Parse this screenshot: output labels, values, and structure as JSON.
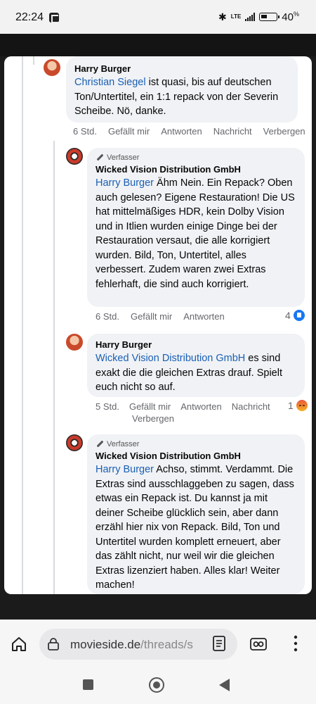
{
  "status_bar": {
    "time": "22:24",
    "network": "LTE",
    "battery": "40",
    "battery_unit": "%"
  },
  "comments": [
    {
      "author": "Harry Burger",
      "author_badge": "",
      "mention": "Christian Siegel",
      "text": " ist quasi, bis auf deutschen Ton/Untertitel, ein 1:1 repack von der Severin Scheibe. Nö, danke.",
      "time": "6 Std.",
      "actions": [
        "Gefällt mir",
        "Antworten",
        "Nachricht",
        "Verbergen"
      ]
    },
    {
      "author": "Wicked Vision Distribution GmbH",
      "author_badge": "Verfasser",
      "mention": "Harry Burger",
      "text": " Ähm Nein. Ein Repack? Oben auch gelesen? Eigene Restauration! Die US hat mittelmäßiges HDR, kein Dolby Vision und in Itlien wurden einige Dinge bei der Restauration versaut, die alle korrigiert wurden. Bild, Ton, Untertitel, alles verbessert. Zudem waren zwei Extras fehlerhaft, die sind auch korrigiert.",
      "time": "6 Std.",
      "actions": [
        "Gefällt mir",
        "Antworten"
      ],
      "reaction_count": "4",
      "reaction_icon": "like-icon"
    },
    {
      "author": "Harry Burger",
      "author_badge": "",
      "mention": "Wicked Vision Distribution GmbH",
      "text": " es sind exakt die die gleichen Extras drauf. Spielt euch nicht so auf.",
      "time": "5 Std.",
      "actions": [
        "Gefällt mir",
        "Antworten",
        "Nachricht",
        "Verbergen"
      ],
      "reaction_count": "1",
      "reaction_icon": "angry-icon"
    },
    {
      "author": "Wicked Vision Distribution GmbH",
      "author_badge": "Verfasser",
      "mention": "Harry Burger",
      "text": " Achso, stimmt. Verdammt. Die Extras sind ausschlaggeben zu sagen, dass etwas ein Repack ist. Du kannst ja mit deiner Scheibe glücklich sein, aber dann erzähl hier nix von Repack. Bild, Ton und Untertitel wurden komplett erneuert, aber das zählt nicht, nur weil wir die gleichen Extras lizenziert haben. Alles klar! Weiter machen!"
    }
  ],
  "browser": {
    "url_host": "movieside.de",
    "url_path": "/threads/s"
  },
  "colors": {
    "mention": "#1a5fb4",
    "bubble": "#f0f2f5",
    "like": "#1877f2"
  }
}
